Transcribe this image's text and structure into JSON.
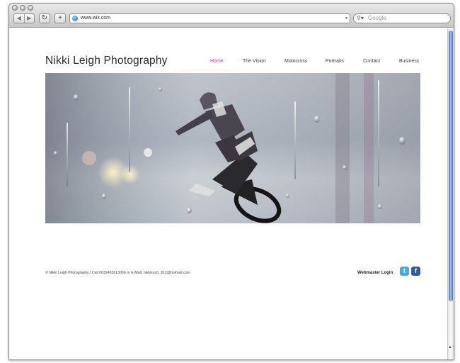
{
  "browser": {
    "url": "www.wix.com",
    "search_placeholder": "Google",
    "back_glyph": "◀",
    "forward_glyph": "▶",
    "reload_glyph": "↻",
    "add_glyph": "+",
    "search_glyph": "⚲▾",
    "url_arrow": "▾",
    "scroll_glyphs": "▲▼"
  },
  "site": {
    "title": "Nikki Leigh Photography",
    "nav": [
      {
        "label": "Home",
        "active": true
      },
      {
        "label": "The Vision",
        "active": false
      },
      {
        "label": "Motocross",
        "active": false
      },
      {
        "label": "Portraits",
        "active": false
      },
      {
        "label": "Contact",
        "active": false
      },
      {
        "label": "Business",
        "active": false
      }
    ],
    "footer": {
      "copyright": "© Nikki Leigh Photography / Call 0032492613066 or E-Mail: nikkiscott_912@hotmail.com",
      "webmaster_label": "Webmaster Login",
      "twitter_glyph": "t",
      "facebook_glyph": "f"
    }
  },
  "colors": {
    "nav_active": "#ce2bc1",
    "twitter": "#48a9e0",
    "facebook": "#3b5998"
  },
  "icons": {
    "twitter": "twitter-icon",
    "facebook": "facebook-icon",
    "banner": "motocross-rider-photo"
  }
}
